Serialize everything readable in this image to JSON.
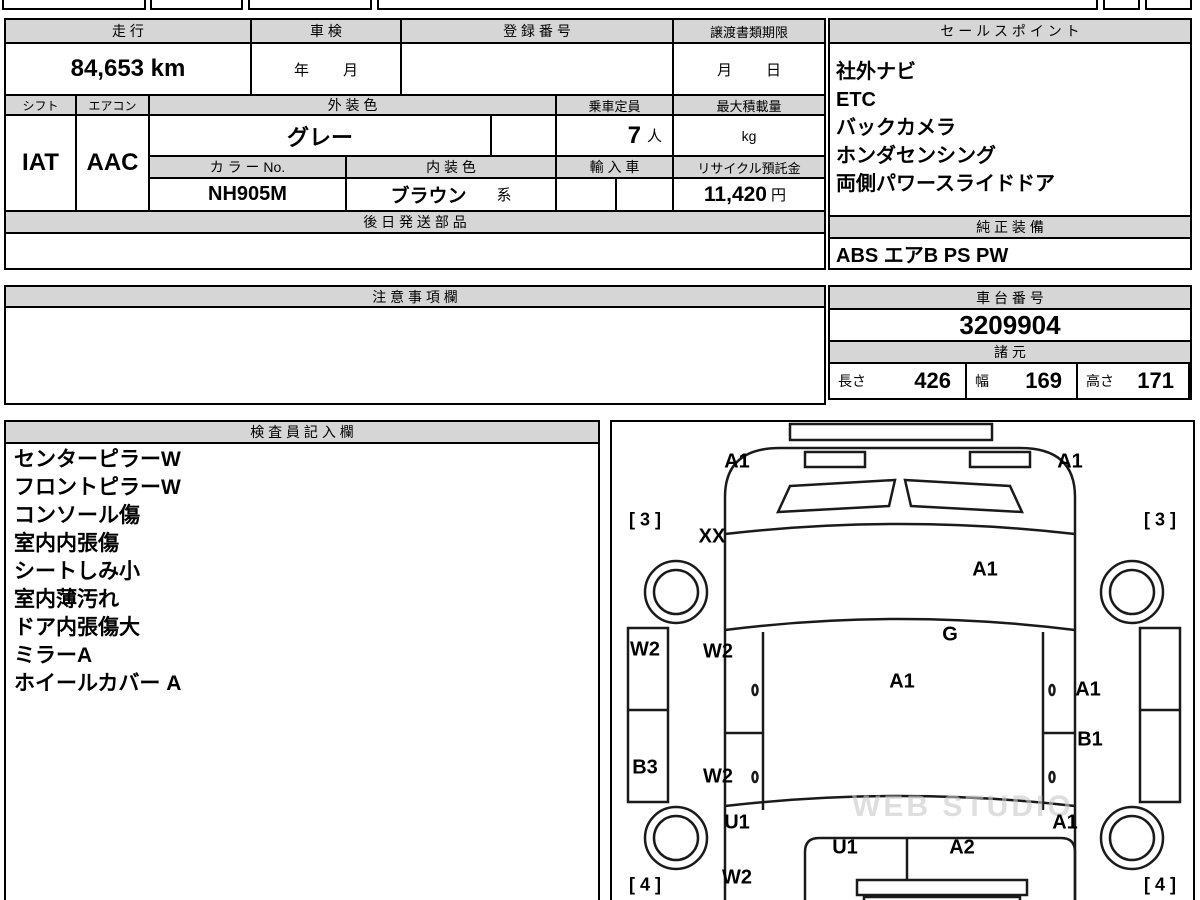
{
  "top_table": {
    "headers": {
      "mileage": "走  行",
      "inspection": "車  検",
      "registration": "登 録 番 号",
      "transfer_deadline": "譲渡書類期限",
      "shift": "シフト",
      "aircon": "エアコン",
      "exterior_color": "外 装 色",
      "capacity": "乗車定員",
      "max_load": "最大積載量",
      "color_no": "カ ラ ー No.",
      "interior_color": "内 装 色",
      "import_car": "輸 入 車",
      "recycle_deposit": "リサイクル預託金",
      "later_shipped_parts": "後 日 発 送 部 品"
    },
    "values": {
      "mileage": "84,653 km",
      "inspection_year": "年",
      "inspection_month": "月",
      "transfer_month": "月",
      "transfer_day": "日",
      "shift": "IAT",
      "aircon": "AAC",
      "exterior_color": "グレー",
      "capacity": "7",
      "capacity_unit": "人",
      "max_load_unit": "kg",
      "color_no": "NH905M",
      "interior_color": "ブラウン",
      "interior_color_suffix": "系",
      "recycle_deposit": "11,420",
      "recycle_unit": "円"
    }
  },
  "notes": {
    "header": "注 意 事 項 欄"
  },
  "sales_points": {
    "header": "セ ー ル ス ポ イ ン ト",
    "items": [
      "社外ナビ",
      "ETC",
      "バックカメラ",
      "ホンダセンシング",
      "両側パワースライドドア"
    ],
    "genuine_header": "純 正 装 備",
    "genuine_equipment": "ABS エアB PS PW"
  },
  "chassis": {
    "header": "車 台 番 号",
    "number": "3209904"
  },
  "specs": {
    "header": "諸  元",
    "length_label": "長さ",
    "length": "426",
    "width_label": "幅",
    "width": "169",
    "height_label": "高さ",
    "height": "171"
  },
  "inspector_notes": {
    "header": "検 査 員 記 入 欄",
    "items": [
      "センターピラーW",
      "フロントピラーW",
      "コンソール傷",
      "室内内張傷",
      "シートしみ小",
      "室内薄汚れ",
      "ドア内張傷大",
      "ミラーA",
      "ホイールカバー A"
    ]
  },
  "diagram": {
    "marks": [
      "A1",
      "A1",
      "[ 3 ]",
      "[ 3 ]",
      "XX",
      "A1",
      "W2",
      "W2",
      "G",
      "A1",
      "A1",
      "B3",
      "W2",
      "B1",
      "U1",
      "A1",
      "U1",
      "A2",
      "W2",
      "[ 4 ]",
      "[ 4 ]"
    ],
    "watermark": "WEB STUDIO"
  }
}
